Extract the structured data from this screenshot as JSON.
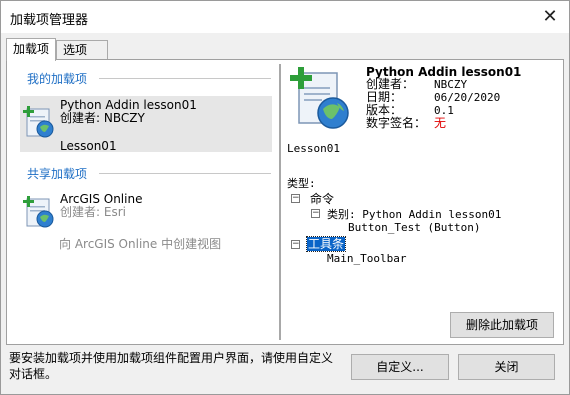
{
  "window": {
    "title": "加载项管理器",
    "close_icon": "close-icon"
  },
  "tabs": [
    {
      "label": "加载项",
      "active": true
    },
    {
      "label": "选项",
      "active": false
    }
  ],
  "left": {
    "my_addins_heading": "我的加载项",
    "my_addins": [
      {
        "name": "Python Addin  lesson01",
        "creator": "创建者: NBCZY",
        "description": "Lesson01",
        "icon": "addin-globe-plus-icon",
        "selected": true
      }
    ],
    "shared_addins_heading": "共享加载项",
    "shared_addins": [
      {
        "name": "ArcGIS Online",
        "creator": "创建者: Esri",
        "icon": "addin-globe-plus-icon"
      }
    ],
    "create_link": "向 ArcGIS Online 中创建视图"
  },
  "detail": {
    "title": "Python Addin lesson01",
    "icon": "addin-large-globe-plus-icon",
    "properties": [
      {
        "label": "创建者：",
        "value": "NBCZY"
      },
      {
        "label": "日期：",
        "value": "06/20/2020"
      },
      {
        "label": "版本：",
        "value": "0.1"
      },
      {
        "label": "数字签名：",
        "value": "无"
      }
    ],
    "description": "Lesson01",
    "types_label": "类型:",
    "tree": {
      "commands_label": "命令",
      "category_label": "类别: Python Addin  lesson01",
      "command_item": "Button_Test (Button)",
      "toolbar_label": "工具条",
      "toolbar_item": "Main_Toolbar",
      "expand_glyph": "⊟"
    },
    "remove_button": "删除此加载项"
  },
  "footer": {
    "hint": "要安装加载项并使用加载项组件配置用户界面，请使用自定义对话框。",
    "customize_button": "自定义...",
    "close_button": "关闭"
  },
  "colors": {
    "section_heading": "#1f6fc5",
    "selection_highlight": "#0a64c8",
    "no_signature": "#e00000"
  }
}
